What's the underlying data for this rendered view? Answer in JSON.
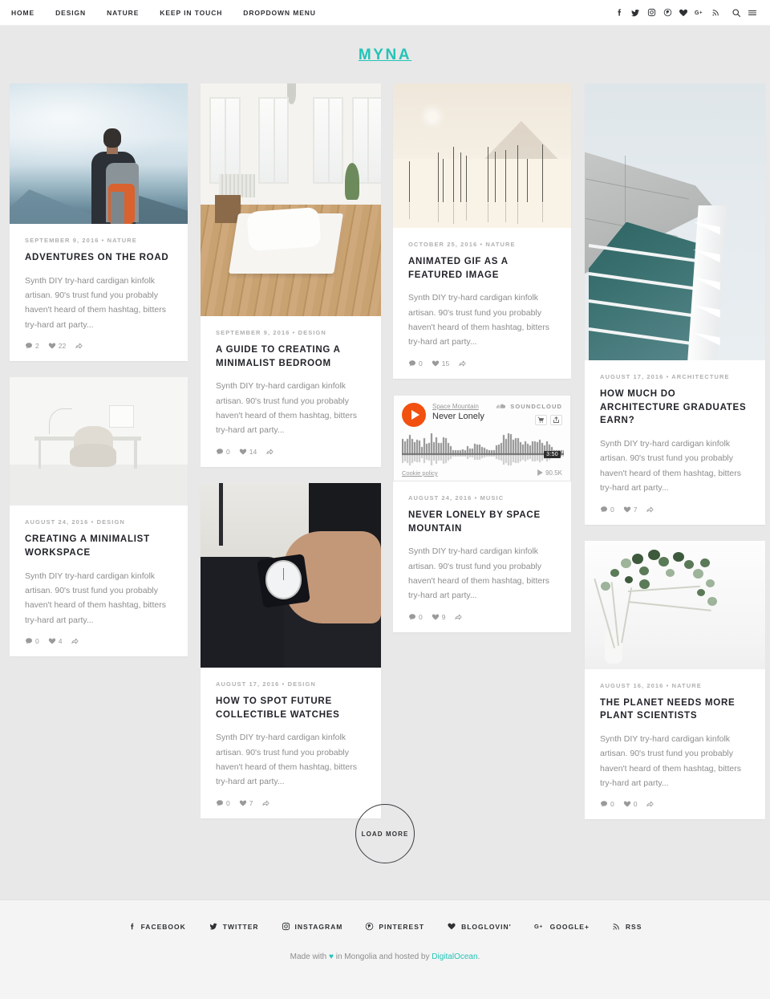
{
  "nav": {
    "links": [
      {
        "label": "HOME"
      },
      {
        "label": "DESIGN"
      },
      {
        "label": "NATURE"
      },
      {
        "label": "KEEP IN TOUCH"
      },
      {
        "label": "DROPDOWN MENU"
      }
    ],
    "icons": [
      {
        "name": "facebook-icon"
      },
      {
        "name": "twitter-icon"
      },
      {
        "name": "instagram-icon"
      },
      {
        "name": "pinterest-icon"
      },
      {
        "name": "bloglovin-heart-icon"
      },
      {
        "name": "googleplus-icon"
      },
      {
        "name": "rss-icon"
      },
      {
        "name": "search-icon"
      },
      {
        "name": "hamburger-menu-icon"
      }
    ]
  },
  "site": {
    "title": "MYNA",
    "title_color": "#23c4b8"
  },
  "posts": [
    {
      "id": "adventures-on-the-road",
      "date": "SEPTEMBER 9, 2016",
      "separator": "•",
      "category": "NATURE",
      "title": "ADVENTURES ON THE ROAD",
      "excerpt": "Synth DIY try-hard cardigan kinfolk artisan. 90's trust fund you probably haven't heard of them hashtag, bitters try-hard art party...",
      "comments": "2",
      "likes": "22",
      "image": "hiker-on-mountain"
    },
    {
      "id": "creating-a-minimalist-workspace",
      "date": "AUGUST 24, 2016",
      "separator": "•",
      "category": "DESIGN",
      "title": "CREATING A MINIMALIST WORKSPACE",
      "excerpt": "Synth DIY try-hard cardigan kinfolk artisan. 90's trust fund you probably haven't heard of them hashtag, bitters try-hard art party...",
      "comments": "0",
      "likes": "4",
      "image": "white-desk-and-chair"
    },
    {
      "id": "a-guide-to-creating-a-minimalist-bedroom",
      "date": "SEPTEMBER 9, 2016",
      "separator": "•",
      "category": "DESIGN",
      "title": "A GUIDE TO CREATING A MINIMALIST BEDROOM",
      "excerpt": "Synth DIY try-hard cardigan kinfolk artisan. 90's trust fund you probably haven't heard of them hashtag, bitters try-hard art party...",
      "comments": "0",
      "likes": "14",
      "image": "minimalist-bedroom"
    },
    {
      "id": "how-to-spot-future-collectible-watches",
      "date": "AUGUST 17, 2016",
      "separator": "•",
      "category": "DESIGN",
      "title": "HOW TO SPOT FUTURE COLLECTIBLE WATCHES",
      "excerpt": "Synth DIY try-hard cardigan kinfolk artisan. 90's trust fund you probably haven't heard of them hashtag, bitters try-hard art party...",
      "comments": "0",
      "likes": "7",
      "image": "wristwatch-on-arm"
    },
    {
      "id": "animated-gif-as-a-featured-image",
      "date": "OCTOBER 25, 2016",
      "separator": "•",
      "category": "NATURE",
      "title": "ANIMATED GIF AS A FEATURED IMAGE",
      "excerpt": "Synth DIY try-hard cardigan kinfolk artisan. 90's trust fund you probably haven't heard of them hashtag, bitters try-hard art party...",
      "comments": "0",
      "likes": "15",
      "image": "beige-minimal-landscape"
    },
    {
      "id": "never-lonely-by-space-mountain",
      "date": "AUGUST 24, 2016",
      "separator": "•",
      "category": "MUSIC",
      "title": "NEVER LONELY BY SPACE MOUNTAIN",
      "excerpt": "Synth DIY try-hard cardigan kinfolk artisan. 90's trust fund you probably haven't heard of them hashtag, bitters try-hard art party...",
      "comments": "0",
      "likes": "9",
      "image": "soundcloud-player"
    },
    {
      "id": "how-much-do-architecture-graduates-earn",
      "date": "AUGUST 17, 2016",
      "separator": "•",
      "category": "ARCHITECTURE",
      "title": "HOW MUCH DO ARCHITECTURE GRADUATES EARN?",
      "excerpt": "Synth DIY try-hard cardigan kinfolk artisan. 90's trust fund you probably haven't heard of them hashtag, bitters try-hard art party...",
      "comments": "0",
      "likes": "7",
      "image": "modern-building-glass-facade"
    },
    {
      "id": "the-planet-needs-more-plant-scientists",
      "date": "AUGUST 16, 2016",
      "separator": "•",
      "category": "NATURE",
      "title": "THE PLANET NEEDS MORE PLANT SCIENTISTS",
      "excerpt": "Synth DIY try-hard cardigan kinfolk artisan. 90's trust fund you probably haven't heard of them hashtag, bitters try-hard art party...",
      "comments": "0",
      "likes": "0",
      "image": "eucalyptus-branch"
    }
  ],
  "soundcloud": {
    "artist": "Space Mountain",
    "track": "Never Lonely",
    "brand": "SOUNDCLOUD",
    "duration": "3:50",
    "plays": "90.5K",
    "cookie_policy": "Cookie policy",
    "play_button": "play-button",
    "buy_button": "cart-icon",
    "share_button": "share-icon",
    "accent_color": "#f2500f"
  },
  "load_more": {
    "label": "LOAD MORE"
  },
  "footer": {
    "social": [
      {
        "name": "facebook",
        "label": "FACEBOOK"
      },
      {
        "name": "twitter",
        "label": "TWITTER"
      },
      {
        "name": "instagram",
        "label": "INSTAGRAM"
      },
      {
        "name": "pinterest",
        "label": "PINTEREST"
      },
      {
        "name": "bloglovin",
        "label": "BLOGLOVIN'"
      },
      {
        "name": "googleplus",
        "label": "GOOGLE+"
      },
      {
        "name": "rss",
        "label": "RSS"
      }
    ],
    "credit": {
      "pre": "Made with",
      "heart": "♥",
      "mid": "in Mongolia and hosted by",
      "link": "DigitalOcean",
      "end": "."
    }
  }
}
